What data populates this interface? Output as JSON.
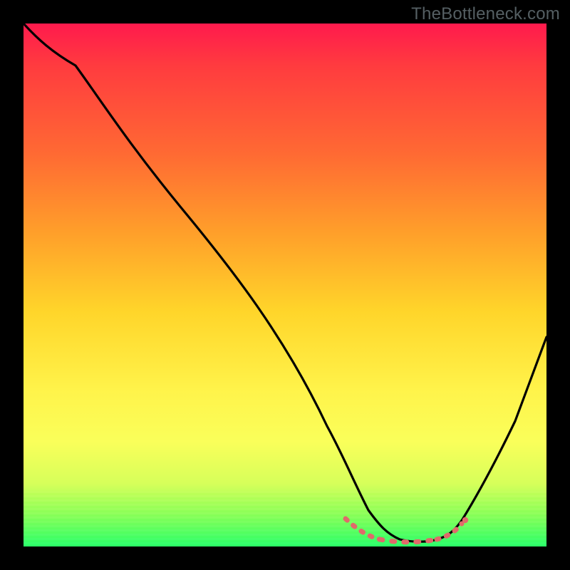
{
  "watermark": "TheBottleneck.com",
  "colors": {
    "background": "#000000",
    "curve": "#000000",
    "highlight": "#e06a6a",
    "gradient_top": "#ff1a4d",
    "gradient_bottom": "#2bff6a"
  },
  "chart_data": {
    "type": "line",
    "title": "",
    "xlabel": "",
    "ylabel": "",
    "xlim": [
      0,
      100
    ],
    "ylim": [
      0,
      100
    ],
    "grid": false,
    "series": [
      {
        "name": "bottleneck-curve",
        "x": [
          0,
          4,
          10,
          20,
          30,
          40,
          50,
          58,
          62,
          66,
          70,
          74,
          78,
          82,
          88,
          94,
          100
        ],
        "y": [
          100,
          97,
          92,
          79,
          65,
          51,
          37,
          23,
          14,
          7,
          3,
          1,
          1,
          2,
          10,
          24,
          40
        ]
      }
    ],
    "annotations": [
      {
        "name": "minimum-region",
        "x_range": [
          62,
          82
        ],
        "y": 1.5,
        "style": "dotted",
        "color": "#e06a6a"
      }
    ]
  }
}
